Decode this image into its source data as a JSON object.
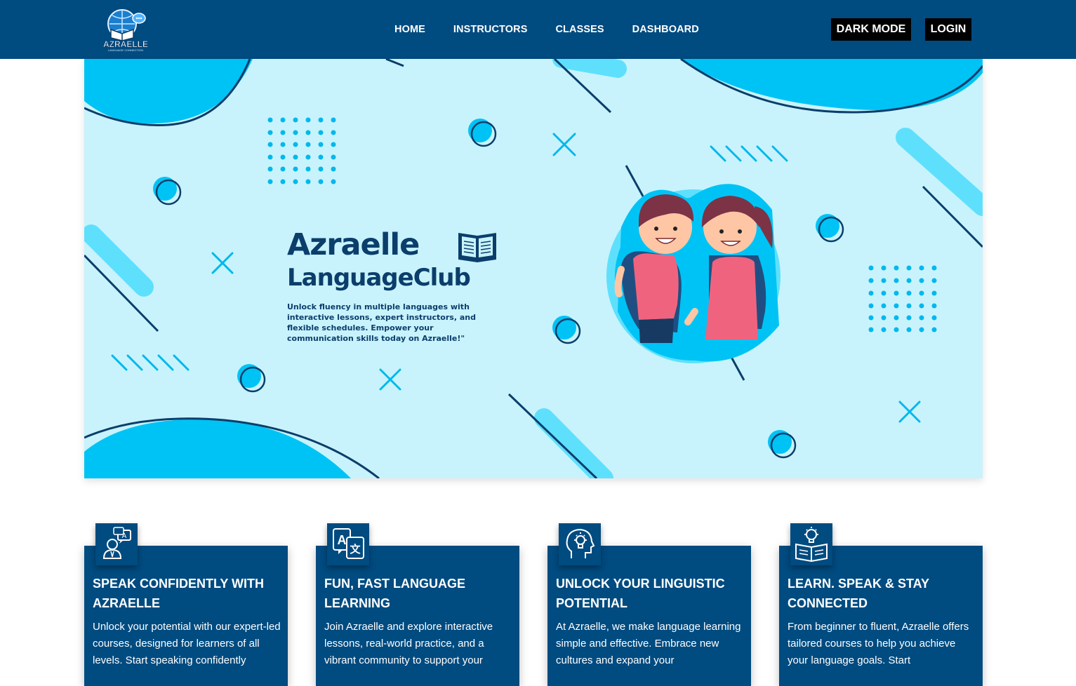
{
  "logo": {
    "text": "AZRAELLE",
    "subtext": "LANGUAGE CONNECTION"
  },
  "nav": {
    "links": [
      "HOME",
      "INSTRUCTORS",
      "CLASSES",
      "DASHBOARD"
    ],
    "dark_mode": "DARK MODE",
    "login": "LOGIN"
  },
  "hero": {
    "title": "Azraelle",
    "subtitle": "LanguageClub",
    "tagline": "Unlock fluency in multiple languages with interactive lessons, expert instructors, and flexible schedules. Empower your communication skills today on Azraelle!\""
  },
  "cards": [
    {
      "icon": "speaking-person-icon",
      "title": "SPEAK CONFIDENTLY WITH AZRAELLE",
      "text": "Unlock your potential with our expert-led courses, designed for learners of all levels. Start speaking confidently"
    },
    {
      "icon": "translate-icon",
      "title": "FUN, FAST LANGUAGE LEARNING",
      "text": "Join Azraelle and explore interactive lessons, real-world practice, and a vibrant community to support your"
    },
    {
      "icon": "lightbulb-head-icon",
      "title": "UNLOCK YOUR LINGUISTIC POTENTIAL",
      "text": "At Azraelle, we make language learning simple and effective. Embrace new cultures and expand your"
    },
    {
      "icon": "book-lightbulb-icon",
      "title": "LEARN. SPEAK & STAY CONNECTED",
      "text": "From beginner to fluent, Azraelle offers tailored courses to help you achieve your language goals. Start"
    }
  ],
  "colors": {
    "navbar": "#004b80",
    "hero_bg": "#c8f3fc",
    "accent": "#00c3f5",
    "dark_navy": "#0b3e6b",
    "button": "#000000"
  }
}
